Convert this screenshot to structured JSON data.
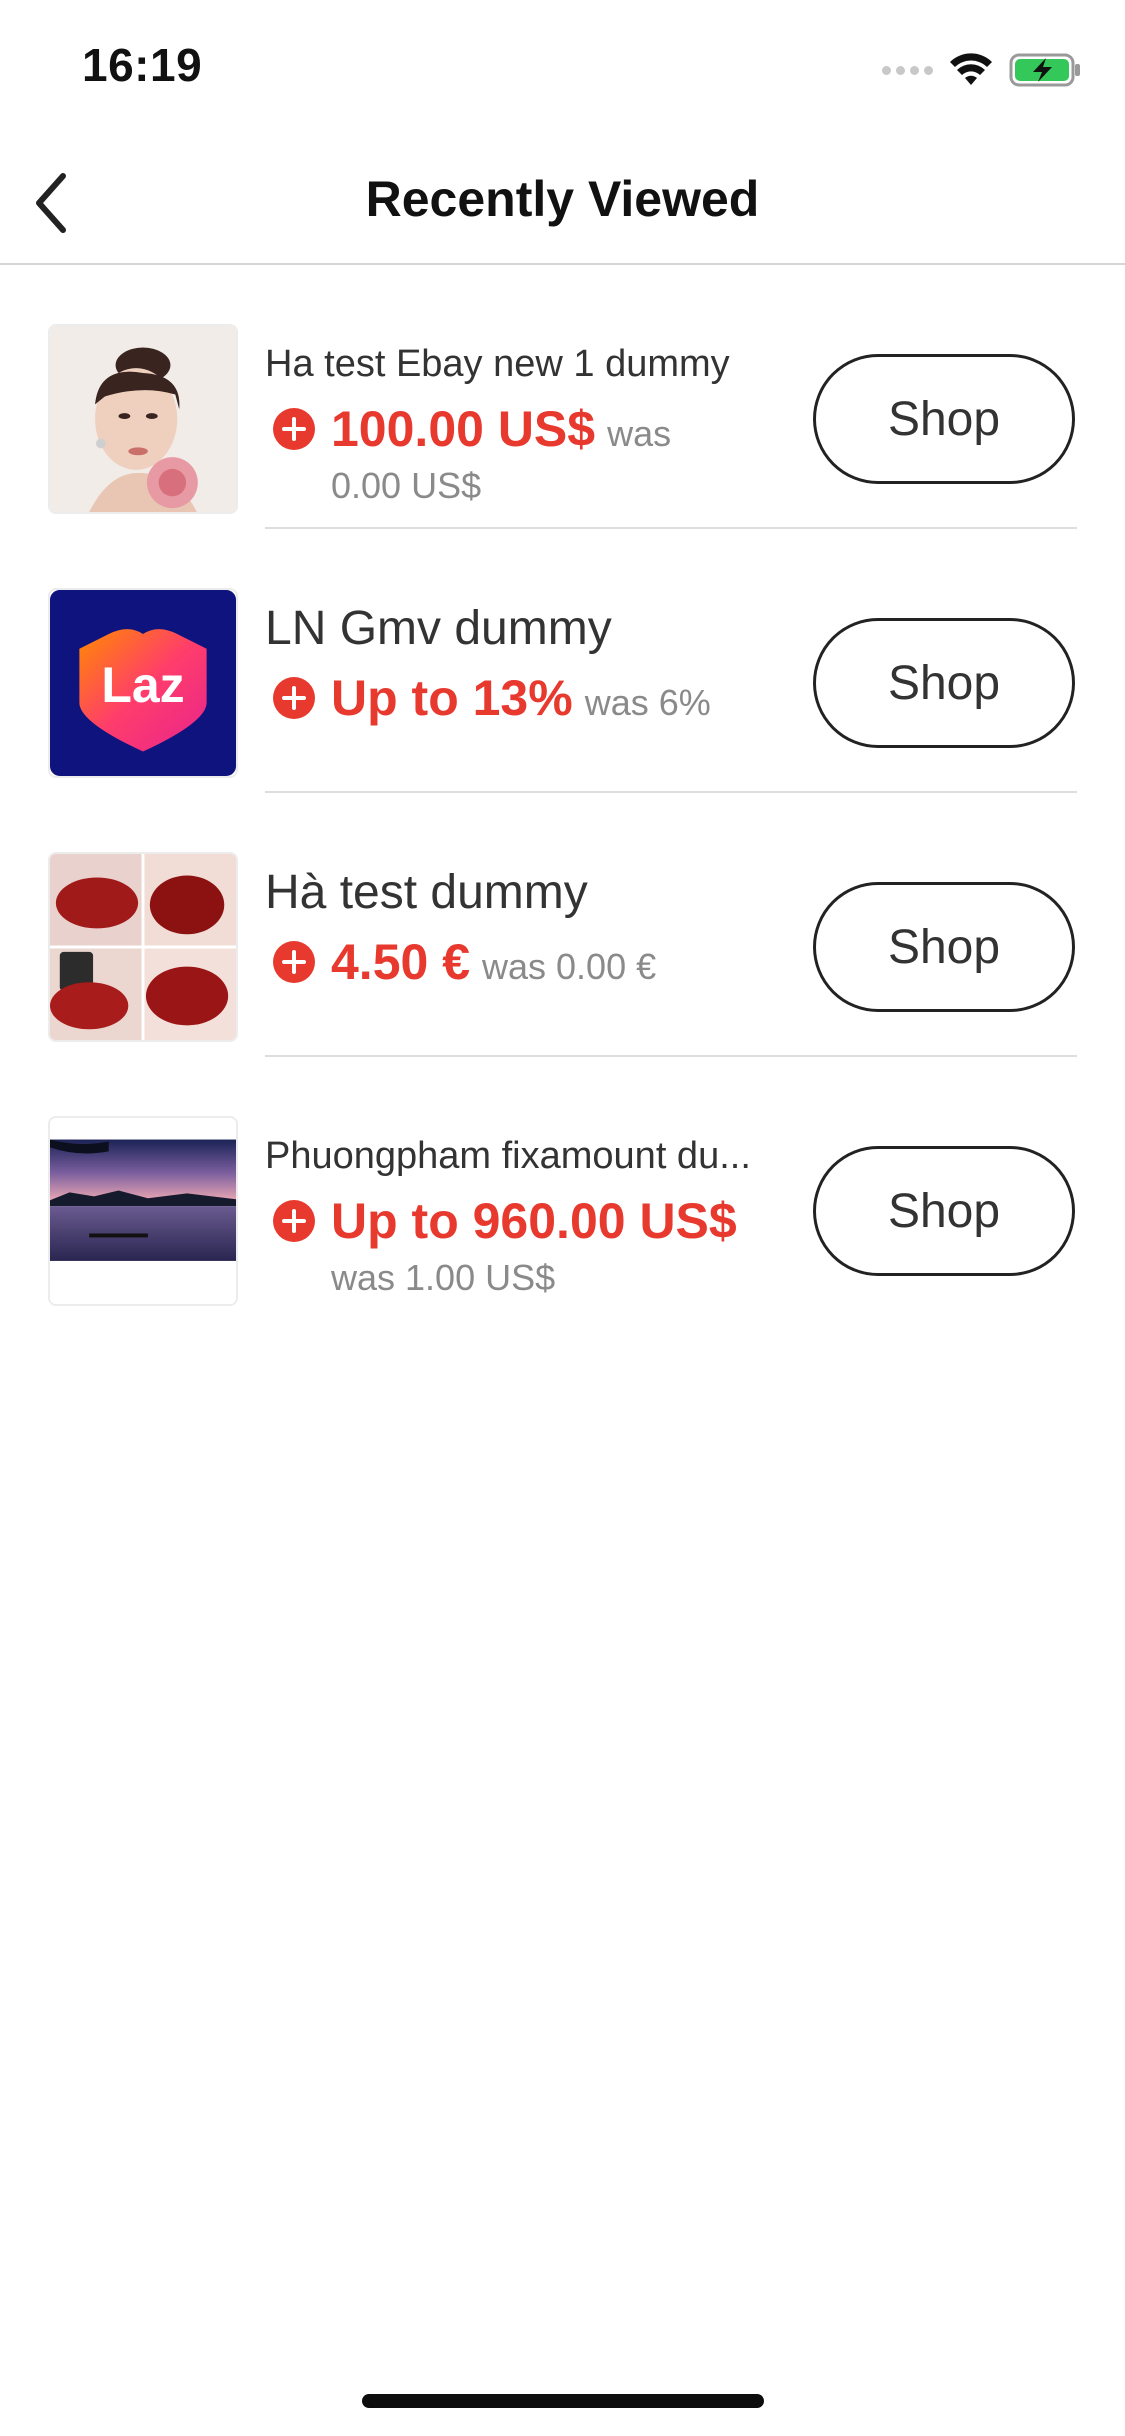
{
  "status_bar": {
    "time": "16:19",
    "signal_icon": "cellular-signal-icon",
    "wifi_icon": "wifi-icon",
    "battery_icon": "battery-charging-icon",
    "battery_color": "#34c759"
  },
  "nav": {
    "back_icon": "chevron-left-icon",
    "title": "Recently Viewed"
  },
  "accent_color": "#e8392f",
  "products": [
    {
      "name": "Ha test Ebay new 1 dummy",
      "price": "100.00 US$",
      "was": "was",
      "was_value": "0.00 US$",
      "shop_label": "Shop",
      "thumb": "portrait-photo"
    },
    {
      "name": "LN Gmv dummy",
      "price": "Up to 13%",
      "was": "was 6%",
      "shop_label": "Shop",
      "thumb": "lazada-logo",
      "logo_text": "Laz"
    },
    {
      "name": "Hà test dummy",
      "price": "4.50 €",
      "was": "was 0.00 €",
      "shop_label": "Shop",
      "thumb": "lipstick-swatches"
    },
    {
      "name": "Phuongpham fixamount du...",
      "price": "Up to 960.00 US$",
      "was": "was 1.00 US$",
      "shop_label": "Shop",
      "thumb": "lake-sunset-photo"
    }
  ]
}
